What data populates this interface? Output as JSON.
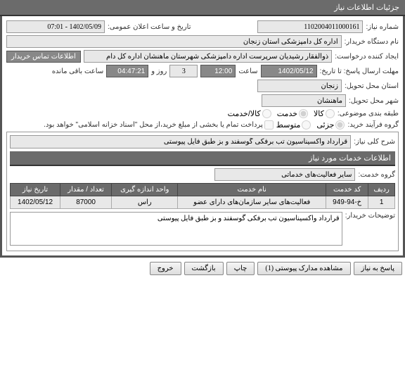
{
  "panel_title": "جزئیات اطلاعات نیاز",
  "fields": {
    "need_no_label": "شماره نیاز:",
    "need_no": "1102004011000161",
    "announce_label": "تاریخ و ساعت اعلان عمومی:",
    "announce": "1402/05/09 - 07:01",
    "buyer_label": "نام دستگاه خریدار:",
    "buyer": "اداره کل دامپزشکی استان زنجان",
    "creator_label": "ایجاد کننده درخواست:",
    "creator": "ذوالفقار رشیدیان سرپرست اداره دامپزشکی شهرستان ماهنشان اداره کل دام",
    "contact_btn": "اطلاعات تماس خریدار",
    "deadline_label": "مهلت ارسال پاسخ: تا تاریخ:",
    "deadline_date": "1402/05/12",
    "time_label": "ساعت",
    "deadline_time": "12:00",
    "days_val": "3",
    "days_label": "روز و",
    "countdown": "04:47:21",
    "remain_label": "ساعت باقی مانده",
    "province_label": "استان محل تحویل:",
    "province": "زنجان",
    "city_label": "شهر محل تحویل:",
    "city": "ماهنشان",
    "subject_label": "طبقه بندی موضوعی:",
    "r_goods": "کالا",
    "r_service": "خدمت",
    "r_both": "کالا/خدمت",
    "process_label": "گروه فرآیند خرید:",
    "r_partial": "جزئی",
    "r_medium": "متوسط",
    "process_note": "پرداخت تمام یا بخشی از مبلغ خرید،از محل \"اسناد خزانه اسلامی\" خواهد بود.",
    "desc_label": "شرح کلی نیاز:",
    "desc": "قرارداد واکسیناسیون تب برفکی گوسفند و بز طبق فایل پیوستی",
    "info_hdr": "اطلاعات خدمات مورد نیاز",
    "group_label": "گروه خدمت:",
    "group": "سایر فعالیت‌های خدماتی"
  },
  "table": {
    "headers": [
      "ردیف",
      "کد خدمت",
      "نام خدمت",
      "واحد اندازه گیری",
      "تعداد / مقدار",
      "تاریخ نیاز"
    ],
    "row": [
      "1",
      "خ-94-949",
      "فعالیت‌های سایر سازمان‌های دارای عضو",
      "راس",
      "87000",
      "1402/05/12"
    ]
  },
  "buyer_note_label": "توضیحات خریدار:",
  "buyer_note": "قرارداد واکسیناسیون تب برفکی گوسفند و بز طبق فایل پیوستی",
  "footer": {
    "reply": "پاسخ به نیاز",
    "attach": "مشاهده مدارک پیوستی (1)",
    "print": "چاپ",
    "back": "بازگشت",
    "exit": "خروج"
  }
}
